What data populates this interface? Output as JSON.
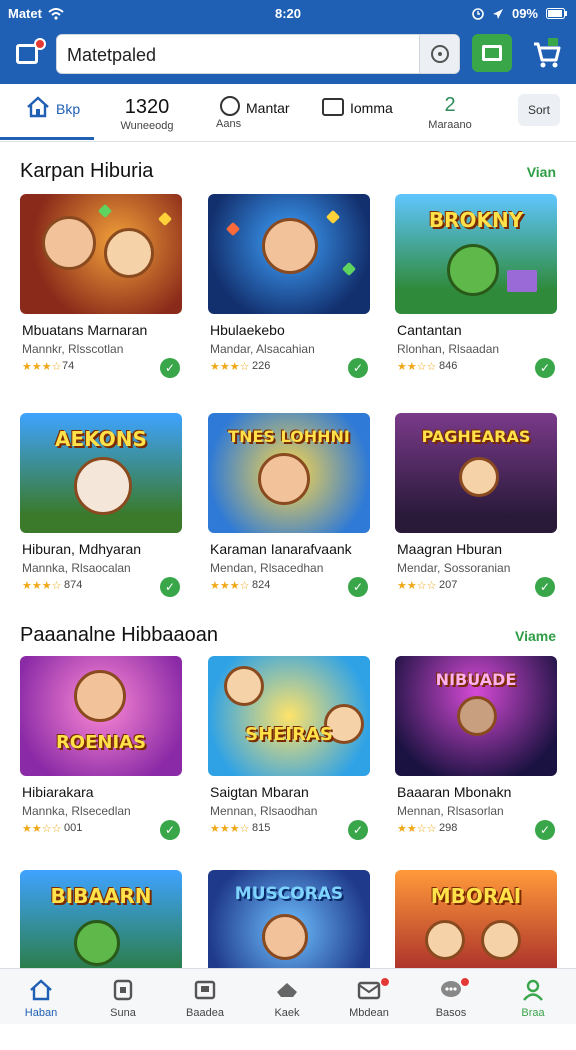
{
  "status_bar": {
    "carrier": "Matet",
    "time": "8:20",
    "battery": "09%"
  },
  "search": {
    "value": "Matetpaled"
  },
  "tabs": {
    "home": {
      "label": "Bkp"
    },
    "count": {
      "value": "1320",
      "label": "Wuneeodg"
    },
    "manual": {
      "label": "Mantar",
      "sub": "Aans"
    },
    "lomma": {
      "label": "Iomma"
    },
    "two": {
      "value": "2",
      "label": "Maraano"
    },
    "sort": {
      "label": "Sort"
    }
  },
  "sections": [
    {
      "title": "Karpan Hiburia",
      "view_label": "Vian",
      "cards": [
        {
          "thumb_title": "",
          "name": "Mbuatans Marnaran",
          "meta": "Mannkr, Rlsscotlan",
          "rating": "74",
          "stars": "★★★☆"
        },
        {
          "thumb_title": "",
          "name": "Hbulaekebo",
          "meta": "Mandar, Alsacahian",
          "rating": "226",
          "stars": "★★★☆"
        },
        {
          "thumb_title": "BROKNY",
          "name": "Cantantan",
          "meta": "Rlonhan, Rlsaadan",
          "rating": "846",
          "stars": "★★☆☆"
        }
      ]
    },
    {
      "title": "",
      "view_label": "",
      "cards": [
        {
          "thumb_title": "AEKONS",
          "name": "Hiburan, Mdhyaran",
          "meta": "Mannka, Rlsaocalan",
          "rating": "874",
          "stars": "★★★☆"
        },
        {
          "thumb_title": "TNES LOHHNI",
          "name": "Karaman Ianarafvaank",
          "meta": "Mendan, Rlsacedhan",
          "rating": "824",
          "stars": "★★★☆"
        },
        {
          "thumb_title": "PAGHEARAS",
          "name": "Maagran Hburan",
          "meta": "Mendar, Sossoranian",
          "rating": "207",
          "stars": "★★☆☆"
        }
      ]
    },
    {
      "title": "Paaanalne Hibbaaoan",
      "view_label": "Viame",
      "cards": [
        {
          "thumb_title": "ROENIAS",
          "name": "Hibiarakara",
          "meta": "Mannka, Rlsecedlan",
          "rating": "001",
          "stars": "★★☆☆"
        },
        {
          "thumb_title": "SHEIRAS",
          "name": "Saigtan Mbaran",
          "meta": "Mennan, Rlsaodhan",
          "rating": "815",
          "stars": "★★★☆"
        },
        {
          "thumb_title": "NIBUADE",
          "name": "Baaaran Mbonakn",
          "meta": "Mennan, Rlsasorlan",
          "rating": "298",
          "stars": "★★☆☆"
        }
      ]
    },
    {
      "title": "",
      "view_label": "",
      "cards": [
        {
          "thumb_title": "BIBAARN",
          "name": "",
          "meta": "",
          "rating": "",
          "stars": ""
        },
        {
          "thumb_title": "MUSCORAS",
          "name": "",
          "meta": "",
          "rating": "",
          "stars": ""
        },
        {
          "thumb_title": "MBORAI",
          "name": "",
          "meta": "",
          "rating": "",
          "stars": ""
        }
      ]
    }
  ],
  "bottom_nav": [
    {
      "label": "Haban",
      "icon": "home-icon"
    },
    {
      "label": "Suna",
      "icon": "square-icon"
    },
    {
      "label": "Baadea",
      "icon": "box-icon"
    },
    {
      "label": "Kaek",
      "icon": "house-outline-icon"
    },
    {
      "label": "Mbdean",
      "icon": "mail-icon"
    },
    {
      "label": "Basos",
      "icon": "chat-icon"
    },
    {
      "label": "Braa",
      "icon": "profile-icon"
    }
  ],
  "colors": {
    "primary": "#1f5fb4",
    "accent_green": "#3aa64a",
    "star": "#f0a818"
  }
}
